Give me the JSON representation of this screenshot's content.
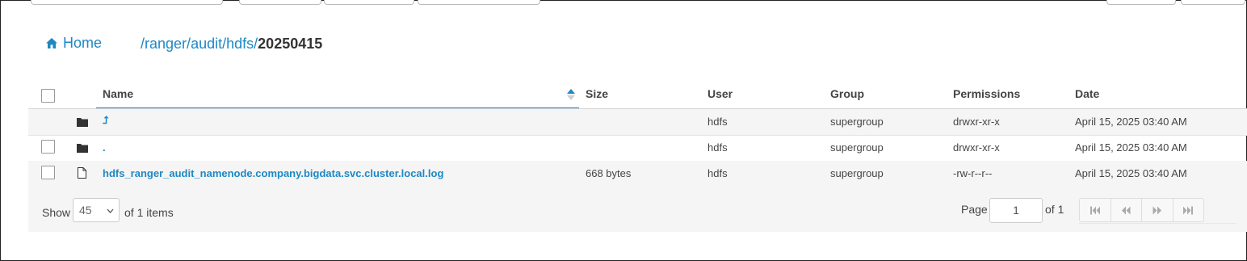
{
  "breadcrumb": {
    "home_label": "Home",
    "segments": [
      "ranger",
      "audit",
      "hdfs"
    ],
    "current": "20250415"
  },
  "table": {
    "columns": {
      "name": "Name",
      "size": "Size",
      "user": "User",
      "group": "Group",
      "permissions": "Permissions",
      "date": "Date"
    },
    "sort": {
      "column": "Name",
      "direction": "ascending"
    },
    "rows": [
      {
        "type": "parent-folder",
        "name": "⮥",
        "size": "",
        "user": "hdfs",
        "group": "supergroup",
        "permissions": "drwxr-xr-x",
        "date": "April 15, 2025 03:40 AM"
      },
      {
        "type": "folder",
        "name": ".",
        "size": "",
        "user": "hdfs",
        "group": "supergroup",
        "permissions": "drwxr-xr-x",
        "date": "April 15, 2025 03:40 AM"
      },
      {
        "type": "file",
        "name": "hdfs_ranger_audit_namenode.company.bigdata.svc.cluster.local.log",
        "size": "668 bytes",
        "user": "hdfs",
        "group": "supergroup",
        "permissions": "-rw-r--r--",
        "date": "April 15, 2025 03:40 AM"
      }
    ]
  },
  "footer": {
    "show_label": "Show",
    "page_size": "45",
    "items_label": "of 1 items",
    "page_label": "Page",
    "page_value": "1",
    "of_pages_label": "of 1"
  },
  "icons": {
    "home": "home-icon",
    "folder": "folder-icon",
    "file": "file-icon",
    "parent": "arrow-up-icon",
    "first": "first-page-icon",
    "prev": "previous-page-icon",
    "next": "next-page-icon",
    "last": "last-page-icon"
  },
  "colors": {
    "link": "#1e88c4",
    "row_alt": "#f5f5f5"
  }
}
